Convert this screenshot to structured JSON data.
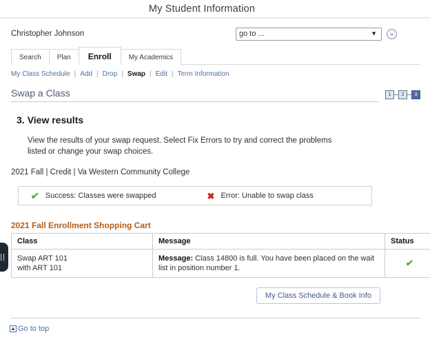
{
  "header": {
    "title": "My Student Information"
  },
  "user": {
    "name": "Christopher Johnson"
  },
  "goto": {
    "value": "go to ...",
    "caret_icon": "chevron-down-icon",
    "submit_label": "»"
  },
  "tabs": [
    {
      "label": "Search",
      "active": false
    },
    {
      "label": "Plan",
      "active": false
    },
    {
      "label": "Enroll",
      "active": true
    },
    {
      "label": "My Academics",
      "active": false
    }
  ],
  "subnav": {
    "items": [
      {
        "label": "My Class Schedule",
        "active": false
      },
      {
        "label": "Add",
        "active": false
      },
      {
        "label": "Drop",
        "active": false
      },
      {
        "label": "Swap",
        "active": true
      },
      {
        "label": "Edit",
        "active": false
      },
      {
        "label": "Term Information",
        "active": false
      }
    ],
    "separator": "|"
  },
  "page": {
    "title": "Swap a Class",
    "steps": [
      {
        "label": "1",
        "state": "done"
      },
      {
        "label": "2",
        "state": "done"
      },
      {
        "label": "3",
        "state": "current"
      }
    ],
    "section_number": "3.",
    "section_title": "View results",
    "instructions": "View the results of your swap request.  Select Fix Errors to try and correct the problems listed or change your swap choices.",
    "term_line": "2021 Fall | Credit | Va Western Community College"
  },
  "legend": {
    "success_icon": "check-icon",
    "success_text": "Success: Classes were swapped",
    "error_icon": "x-icon",
    "error_text": "Error: Unable to swap class"
  },
  "cart": {
    "title": "2021 Fall Enrollment Shopping Cart",
    "columns": [
      "Class",
      "Message",
      "Status"
    ],
    "rows": [
      {
        "class_line1": "Swap ART  101",
        "class_line2": "with ART  101",
        "message_label": "Message:",
        "message_text": " Class 14800 is full. You have been placed on the wait list in position number 1.",
        "status_icon": "check-icon"
      }
    ]
  },
  "actions": {
    "schedule_button": "My Class Schedule & Book Info"
  },
  "footer": {
    "goto_top_icon": "arrow-up-icon",
    "goto_top_label": "Go to top"
  },
  "side_handle": {
    "icon": "collapse-handle-icon",
    "glyph": "||"
  },
  "colors": {
    "link": "#4a6fa5",
    "cart_title": "#b35e17",
    "success": "#4caf2e",
    "error": "#d0201a",
    "step_active": "#4f6ba3",
    "page_title": "#4e5b73"
  }
}
